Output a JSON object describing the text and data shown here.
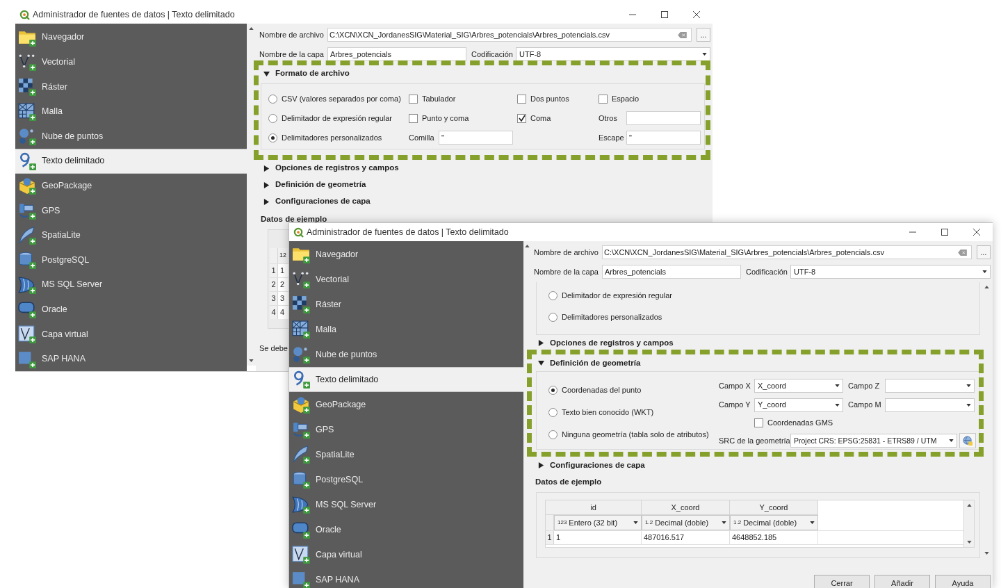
{
  "back_window": {
    "title": "Administrador de fuentes de datos | Texto delimitado",
    "sidebar": [
      {
        "label": "Navegador",
        "selected": false
      },
      {
        "label": "Vectorial",
        "selected": false
      },
      {
        "label": "Ráster",
        "selected": false
      },
      {
        "label": "Malla",
        "selected": false
      },
      {
        "label": "Nube de puntos",
        "selected": false
      },
      {
        "label": "Texto delimitado",
        "selected": true
      },
      {
        "label": "GeoPackage",
        "selected": false
      },
      {
        "label": "GPS",
        "selected": false
      },
      {
        "label": "SpatiaLite",
        "selected": false
      },
      {
        "label": "PostgreSQL",
        "selected": false
      },
      {
        "label": "MS SQL Server",
        "selected": false
      },
      {
        "label": "Oracle",
        "selected": false
      },
      {
        "label": "Capa virtual",
        "selected": false
      },
      {
        "label": "SAP HANA",
        "selected": false
      }
    ],
    "file_name": {
      "label": "Nombre de archivo",
      "value": "C:\\XCN\\XCN_JordanesSIG\\Material_SIG\\Arbres_potencials\\Arbres_potencials.csv",
      "browse": "..."
    },
    "layer_name": {
      "label": "Nombre de la capa",
      "value": "Arbres_potencials"
    },
    "encoding": {
      "label": "Codificación",
      "value": "UTF-8"
    },
    "sections": [
      {
        "kind": "format",
        "title": "Formato de archivo",
        "expanded": true,
        "highlighted": true
      },
      {
        "title": "Opciones de registros y campos",
        "expanded": false,
        "highlighted": false
      },
      {
        "title": "Definición de geometría",
        "expanded": false,
        "highlighted": false
      },
      {
        "title": "Configuraciones de capa",
        "expanded": false,
        "highlighted": false
      }
    ],
    "file_format": {
      "radios": [
        {
          "label": "CSV (valores separados por coma)",
          "selected": false
        },
        {
          "label": "Delimitador de expresión regular",
          "selected": false
        },
        {
          "label": "Delimitadores personalizados",
          "selected": true
        }
      ],
      "delimiters": [
        {
          "label": "Tabulador",
          "checked": false
        },
        {
          "label": "Dos puntos",
          "checked": false
        },
        {
          "label": "Espacio",
          "checked": false
        },
        {
          "label": "Punto y coma",
          "checked": false
        },
        {
          "label": "Coma",
          "checked": true
        }
      ],
      "other": {
        "label": "Otros"
      },
      "quote": {
        "label": "Comilla",
        "value": "\""
      },
      "escape": {
        "label": "Escape",
        "value": "\""
      }
    },
    "sample": {
      "title": "Datos de ejemplo",
      "column_header": "12",
      "rows": [
        {
          "number": "1",
          "value": "1"
        },
        {
          "number": "2",
          "value": "2"
        },
        {
          "number": "3",
          "value": "3"
        },
        {
          "number": "4",
          "value": "4"
        }
      ],
      "note": "Se debe"
    }
  },
  "front_window": {
    "title": "Administrador de fuentes de datos | Texto delimitado",
    "sidebar": [
      {
        "label": "Navegador",
        "selected": false
      },
      {
        "label": "Vectorial",
        "selected": false
      },
      {
        "label": "Ráster",
        "selected": false
      },
      {
        "label": "Malla",
        "selected": false
      },
      {
        "label": "Nube de puntos",
        "selected": false
      },
      {
        "label": "Texto delimitado",
        "selected": true
      },
      {
        "label": "GeoPackage",
        "selected": false
      },
      {
        "label": "GPS",
        "selected": false
      },
      {
        "label": "SpatiaLite",
        "selected": false
      },
      {
        "label": "PostgreSQL",
        "selected": false
      },
      {
        "label": "MS SQL Server",
        "selected": false
      },
      {
        "label": "Oracle",
        "selected": false
      },
      {
        "label": "Capa virtual",
        "selected": false
      },
      {
        "label": "SAP HANA",
        "selected": false
      }
    ],
    "file_name": {
      "label": "Nombre de archivo",
      "value": "C:\\XCN\\XCN_JordanesSIG\\Material_SIG\\Arbres_potencials\\Arbres_potencials.csv",
      "browse": "..."
    },
    "layer_name": {
      "label": "Nombre de la capa",
      "value": "Arbres_potencials"
    },
    "encoding": {
      "label": "Codificación",
      "value": "UTF-8"
    },
    "format_tail": {
      "radios": [
        {
          "label": "Delimitador de expresión regular",
          "selected": false
        },
        {
          "label": "Delimitadores personalizados",
          "selected": false
        }
      ]
    },
    "sections": [
      {
        "title": "Opciones de registros y campos",
        "expanded": false,
        "highlighted": false
      },
      {
        "kind": "geometry",
        "title": "Definición de geometría",
        "expanded": true,
        "highlighted": true
      },
      {
        "title": "Configuraciones de capa",
        "expanded": false,
        "highlighted": false
      }
    ],
    "geometry": {
      "radios": [
        {
          "label": "Coordenadas del punto",
          "selected": true
        },
        {
          "label": "Texto bien conocido (WKT)",
          "selected": false
        },
        {
          "label": "Ninguna geometría (tabla solo de atributos)",
          "selected": false
        }
      ],
      "fields": [
        {
          "label": "Campo X",
          "value": "X_coord"
        },
        {
          "label": "Campo Z"
        },
        {
          "label": "Campo Y",
          "value": "Y_coord"
        },
        {
          "label": "Campo M"
        }
      ],
      "dms": {
        "label": "Coordenadas GMS",
        "checked": false
      },
      "crs": {
        "label": "SRC de la geometría",
        "value": "Project CRS: EPSG:25831 - ETRS89 / UTM"
      }
    },
    "sample": {
      "title": "Datos de ejemplo",
      "columns": [
        {
          "name": "id",
          "type_icon": "123",
          "type": "Entero (32 bit)"
        },
        {
          "name": "X_coord",
          "type_icon": "1.2",
          "type": "Decimal (doble)"
        },
        {
          "name": "Y_coord",
          "type_icon": "1.2",
          "type": "Decimal (doble)"
        }
      ],
      "rows": [
        {
          "number": "1",
          "cells": [
            "1",
            "487016.517",
            "4648852.185"
          ]
        }
      ]
    },
    "buttons": [
      "Cerrar",
      "Añadir",
      "Ayuda"
    ]
  }
}
